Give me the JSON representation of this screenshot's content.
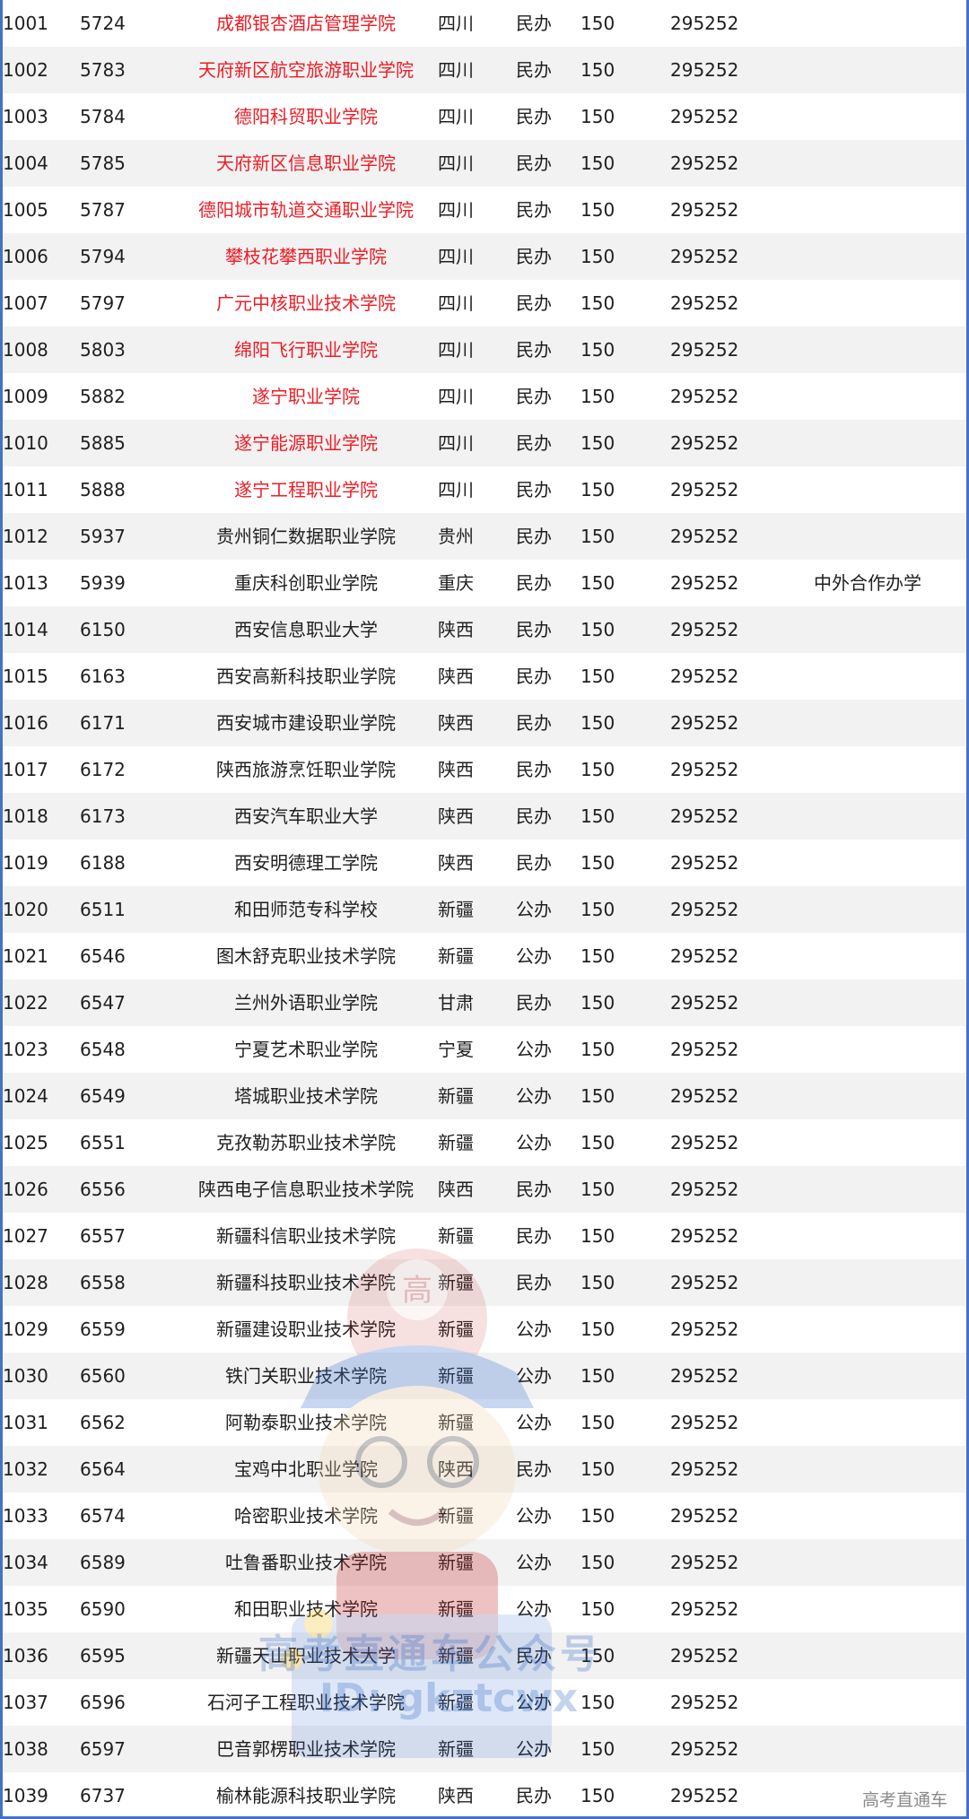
{
  "rows": [
    {
      "idx": "1001",
      "code": "5724",
      "name": "成都银杏酒店管理学院",
      "prov": "四川",
      "type": "民办",
      "num": "150",
      "rank": "295252",
      "note": "",
      "red": true
    },
    {
      "idx": "1002",
      "code": "5783",
      "name": "天府新区航空旅游职业学院",
      "prov": "四川",
      "type": "民办",
      "num": "150",
      "rank": "295252",
      "note": "",
      "red": true
    },
    {
      "idx": "1003",
      "code": "5784",
      "name": "德阳科贸职业学院",
      "prov": "四川",
      "type": "民办",
      "num": "150",
      "rank": "295252",
      "note": "",
      "red": true
    },
    {
      "idx": "1004",
      "code": "5785",
      "name": "天府新区信息职业学院",
      "prov": "四川",
      "type": "民办",
      "num": "150",
      "rank": "295252",
      "note": "",
      "red": true
    },
    {
      "idx": "1005",
      "code": "5787",
      "name": "德阳城市轨道交通职业学院",
      "prov": "四川",
      "type": "民办",
      "num": "150",
      "rank": "295252",
      "note": "",
      "red": true
    },
    {
      "idx": "1006",
      "code": "5794",
      "name": "攀枝花攀西职业学院",
      "prov": "四川",
      "type": "民办",
      "num": "150",
      "rank": "295252",
      "note": "",
      "red": true
    },
    {
      "idx": "1007",
      "code": "5797",
      "name": "广元中核职业技术学院",
      "prov": "四川",
      "type": "民办",
      "num": "150",
      "rank": "295252",
      "note": "",
      "red": true
    },
    {
      "idx": "1008",
      "code": "5803",
      "name": "绵阳飞行职业学院",
      "prov": "四川",
      "type": "民办",
      "num": "150",
      "rank": "295252",
      "note": "",
      "red": true
    },
    {
      "idx": "1009",
      "code": "5882",
      "name": "遂宁职业学院",
      "prov": "四川",
      "type": "民办",
      "num": "150",
      "rank": "295252",
      "note": "",
      "red": true
    },
    {
      "idx": "1010",
      "code": "5885",
      "name": "遂宁能源职业学院",
      "prov": "四川",
      "type": "民办",
      "num": "150",
      "rank": "295252",
      "note": "",
      "red": true
    },
    {
      "idx": "1011",
      "code": "5888",
      "name": "遂宁工程职业学院",
      "prov": "四川",
      "type": "民办",
      "num": "150",
      "rank": "295252",
      "note": "",
      "red": true
    },
    {
      "idx": "1012",
      "code": "5937",
      "name": "贵州铜仁数据职业学院",
      "prov": "贵州",
      "type": "民办",
      "num": "150",
      "rank": "295252",
      "note": "",
      "red": false
    },
    {
      "idx": "1013",
      "code": "5939",
      "name": "重庆科创职业学院",
      "prov": "重庆",
      "type": "民办",
      "num": "150",
      "rank": "295252",
      "note": "中外合作办学",
      "red": false
    },
    {
      "idx": "1014",
      "code": "6150",
      "name": "西安信息职业大学",
      "prov": "陕西",
      "type": "民办",
      "num": "150",
      "rank": "295252",
      "note": "",
      "red": false
    },
    {
      "idx": "1015",
      "code": "6163",
      "name": "西安高新科技职业学院",
      "prov": "陕西",
      "type": "民办",
      "num": "150",
      "rank": "295252",
      "note": "",
      "red": false
    },
    {
      "idx": "1016",
      "code": "6171",
      "name": "西安城市建设职业学院",
      "prov": "陕西",
      "type": "民办",
      "num": "150",
      "rank": "295252",
      "note": "",
      "red": false
    },
    {
      "idx": "1017",
      "code": "6172",
      "name": "陕西旅游烹饪职业学院",
      "prov": "陕西",
      "type": "民办",
      "num": "150",
      "rank": "295252",
      "note": "",
      "red": false
    },
    {
      "idx": "1018",
      "code": "6173",
      "name": "西安汽车职业大学",
      "prov": "陕西",
      "type": "民办",
      "num": "150",
      "rank": "295252",
      "note": "",
      "red": false
    },
    {
      "idx": "1019",
      "code": "6188",
      "name": "西安明德理工学院",
      "prov": "陕西",
      "type": "民办",
      "num": "150",
      "rank": "295252",
      "note": "",
      "red": false
    },
    {
      "idx": "1020",
      "code": "6511",
      "name": "和田师范专科学校",
      "prov": "新疆",
      "type": "公办",
      "num": "150",
      "rank": "295252",
      "note": "",
      "red": false
    },
    {
      "idx": "1021",
      "code": "6546",
      "name": "图木舒克职业技术学院",
      "prov": "新疆",
      "type": "公办",
      "num": "150",
      "rank": "295252",
      "note": "",
      "red": false
    },
    {
      "idx": "1022",
      "code": "6547",
      "name": "兰州外语职业学院",
      "prov": "甘肃",
      "type": "民办",
      "num": "150",
      "rank": "295252",
      "note": "",
      "red": false
    },
    {
      "idx": "1023",
      "code": "6548",
      "name": "宁夏艺术职业学院",
      "prov": "宁夏",
      "type": "公办",
      "num": "150",
      "rank": "295252",
      "note": "",
      "red": false
    },
    {
      "idx": "1024",
      "code": "6549",
      "name": "塔城职业技术学院",
      "prov": "新疆",
      "type": "公办",
      "num": "150",
      "rank": "295252",
      "note": "",
      "red": false
    },
    {
      "idx": "1025",
      "code": "6551",
      "name": "克孜勒苏职业技术学院",
      "prov": "新疆",
      "type": "公办",
      "num": "150",
      "rank": "295252",
      "note": "",
      "red": false
    },
    {
      "idx": "1026",
      "code": "6556",
      "name": "陕西电子信息职业技术学院",
      "prov": "陕西",
      "type": "民办",
      "num": "150",
      "rank": "295252",
      "note": "",
      "red": false
    },
    {
      "idx": "1027",
      "code": "6557",
      "name": "新疆科信职业技术学院",
      "prov": "新疆",
      "type": "民办",
      "num": "150",
      "rank": "295252",
      "note": "",
      "red": false
    },
    {
      "idx": "1028",
      "code": "6558",
      "name": "新疆科技职业技术学院",
      "prov": "新疆",
      "type": "民办",
      "num": "150",
      "rank": "295252",
      "note": "",
      "red": false
    },
    {
      "idx": "1029",
      "code": "6559",
      "name": "新疆建设职业技术学院",
      "prov": "新疆",
      "type": "公办",
      "num": "150",
      "rank": "295252",
      "note": "",
      "red": false
    },
    {
      "idx": "1030",
      "code": "6560",
      "name": "铁门关职业技术学院",
      "prov": "新疆",
      "type": "公办",
      "num": "150",
      "rank": "295252",
      "note": "",
      "red": false
    },
    {
      "idx": "1031",
      "code": "6562",
      "name": "阿勒泰职业技术学院",
      "prov": "新疆",
      "type": "公办",
      "num": "150",
      "rank": "295252",
      "note": "",
      "red": false
    },
    {
      "idx": "1032",
      "code": "6564",
      "name": "宝鸡中北职业学院",
      "prov": "陕西",
      "type": "民办",
      "num": "150",
      "rank": "295252",
      "note": "",
      "red": false
    },
    {
      "idx": "1033",
      "code": "6574",
      "name": "哈密职业技术学院",
      "prov": "新疆",
      "type": "公办",
      "num": "150",
      "rank": "295252",
      "note": "",
      "red": false
    },
    {
      "idx": "1034",
      "code": "6589",
      "name": "吐鲁番职业技术学院",
      "prov": "新疆",
      "type": "公办",
      "num": "150",
      "rank": "295252",
      "note": "",
      "red": false
    },
    {
      "idx": "1035",
      "code": "6590",
      "name": "和田职业技术学院",
      "prov": "新疆",
      "type": "公办",
      "num": "150",
      "rank": "295252",
      "note": "",
      "red": false
    },
    {
      "idx": "1036",
      "code": "6595",
      "name": "新疆天山职业技术大学",
      "prov": "新疆",
      "type": "民办",
      "num": "150",
      "rank": "295252",
      "note": "",
      "red": false
    },
    {
      "idx": "1037",
      "code": "6596",
      "name": "石河子工程职业技术学院",
      "prov": "新疆",
      "type": "公办",
      "num": "150",
      "rank": "295252",
      "note": "",
      "red": false
    },
    {
      "idx": "1038",
      "code": "6597",
      "name": "巴音郭楞职业技术学院",
      "prov": "新疆",
      "type": "公办",
      "num": "150",
      "rank": "295252",
      "note": "",
      "red": false
    },
    {
      "idx": "1039",
      "code": "6737",
      "name": "榆林能源科技职业学院",
      "prov": "陕西",
      "type": "民办",
      "num": "150",
      "rank": "295252",
      "note": "",
      "red": false
    }
  ],
  "watermark": {
    "badge_char": "高",
    "text": "高考直通车公众号",
    "id_text": "ID: gkztcwx"
  },
  "footer": {
    "brand": "高考直通车"
  },
  "colors": {
    "highlight_red": "#ee1c25",
    "border_blue": "#4472c4",
    "stripe_gray": "#f2f2f2",
    "watermark_blue": "#2f66c4"
  }
}
